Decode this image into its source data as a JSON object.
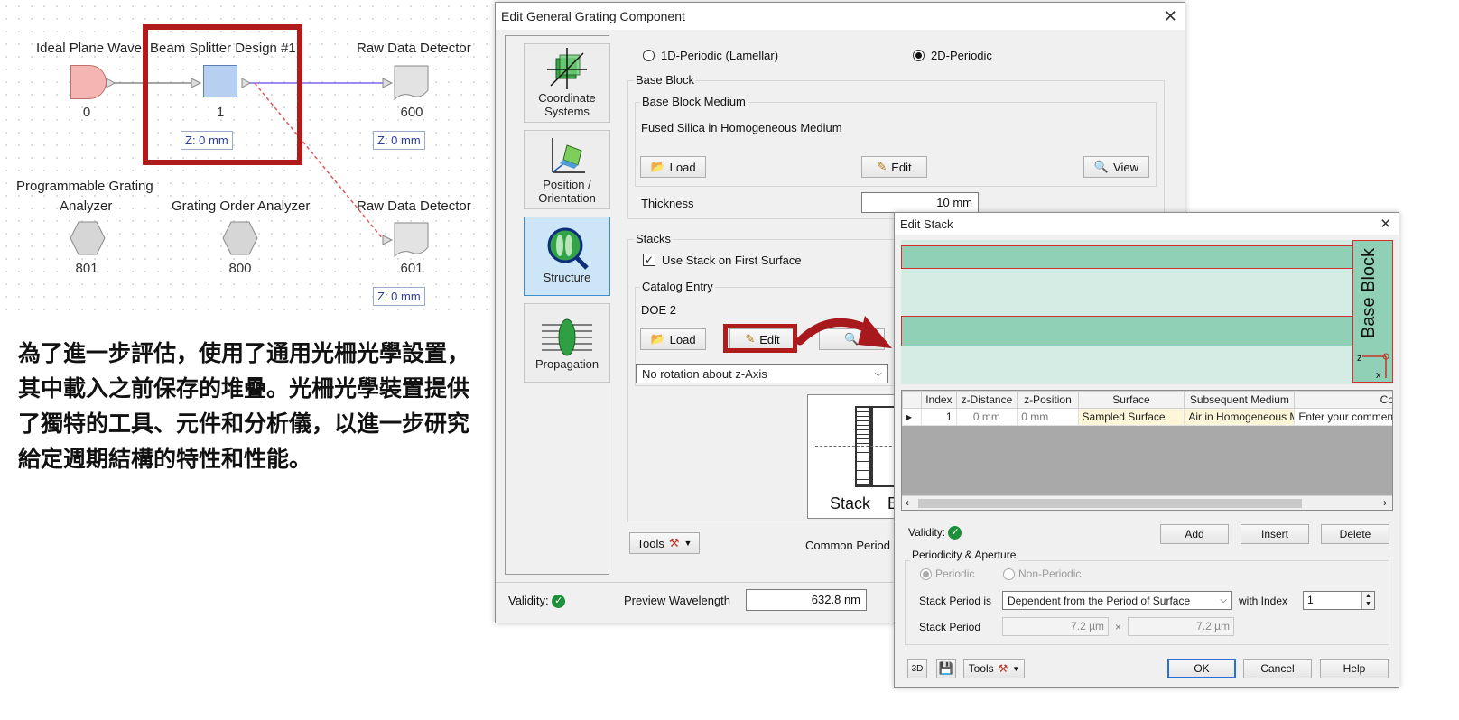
{
  "flow": {
    "nodes": {
      "ideal_plane_wave": {
        "label": "Ideal Plane Wave",
        "index": "0"
      },
      "beam_splitter": {
        "label": "Beam Splitter Design #1",
        "index": "1",
        "z": "Z: 0 mm"
      },
      "raw_detector_top": {
        "label": "Raw Data Detector",
        "index": "600",
        "z": "Z: 0 mm"
      },
      "prog_grating_analyzer": {
        "label_line1": "Programmable Grating",
        "label_line2": "Analyzer",
        "index": "801"
      },
      "grating_order_analyzer": {
        "label": "Grating Order Analyzer",
        "index": "800"
      },
      "raw_detector_bottom": {
        "label": "Raw Data Detector",
        "index": "601",
        "z": "Z: 0 mm"
      }
    },
    "colors": {
      "source": "#f4b6b2",
      "component": "#b7cff0",
      "highlight": "#b01c1c",
      "link": "#7b68ee"
    }
  },
  "description": "為了進一步評估，使用了通用光柵光學設置，其中載入之前保存的堆疊。光柵光學裝置提供了獨特的工具、元件和分析儀，以進一步研究給定週期結構的特性和性能。",
  "grating_dialog": {
    "title": "Edit General Grating Component",
    "nav": [
      {
        "label_line1": "Coordinate",
        "label_line2": "Systems",
        "icon": "coordinate-systems-icon"
      },
      {
        "label_line1": "Position /",
        "label_line2": "Orientation",
        "icon": "position-orientation-icon"
      },
      {
        "label_line1": "Structure",
        "label_line2": "",
        "icon": "structure-icon"
      },
      {
        "label_line1": "Propagation",
        "label_line2": "",
        "icon": "propagation-icon"
      }
    ],
    "periodic_1d": "1D-Periodic (Lamellar)",
    "periodic_2d": "2D-Periodic",
    "base_block_title": "Base Block",
    "base_block_medium_title": "Base Block Medium",
    "medium_value": "Fused Silica in Homogeneous Medium",
    "load": "Load",
    "edit": "Edit",
    "view": "View",
    "thickness_label": "Thickness",
    "thickness_value": "10 mm",
    "stacks_title": "Stacks",
    "use_stack": "Use Stack on First Surface",
    "catalog_entry_title": "Catalog Entry",
    "catalog_value": "DOE 2",
    "rotation_option": "No rotation about z-Axis",
    "preview_stack_label": "Stack",
    "preview_base_label": "B",
    "tools": "Tools",
    "common_period": "Common Period",
    "validity": "Validity:",
    "preview_wavelength_label": "Preview Wavelength",
    "preview_wavelength_value": "632.8 nm"
  },
  "stack_dialog": {
    "title": "Edit Stack",
    "base_block_label": "Base Block",
    "axis_z": "z",
    "axis_x": "x",
    "table": {
      "headers": [
        "",
        "Index",
        "z-Distance",
        "z-Position",
        "Surface",
        "Subsequent Medium",
        "Com"
      ],
      "rows": [
        [
          "▸",
          "1",
          "0 mm",
          "0 mm",
          "Sampled Surface",
          "Air in Homogeneous M",
          "Enter your commen"
        ]
      ]
    },
    "validity": "Validity:",
    "add": "Add",
    "insert": "Insert",
    "delete": "Delete",
    "periodicity_title": "Periodicity & Aperture",
    "periodic": "Periodic",
    "non_periodic": "Non-Periodic",
    "stack_period_is": "Stack Period is",
    "dependency_option": "Dependent from the Period of Surface",
    "with_index": "with Index",
    "index_value": "1",
    "stack_period_label": "Stack Period",
    "period_x": "7.2 µm",
    "times": "×",
    "period_y": "7.2 µm",
    "tools": "Tools",
    "ok": "OK",
    "cancel": "Cancel",
    "help": "Help"
  }
}
